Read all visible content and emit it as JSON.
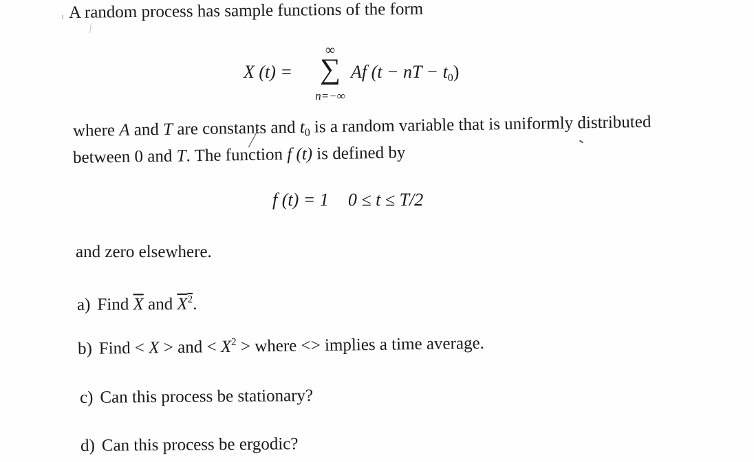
{
  "document": {
    "intro": "A random process has sample functions of the form",
    "equation_1": {
      "lhs": "X (t) =",
      "sum_upper": "∞",
      "sum_symbol": "∑",
      "sum_lower": "n=−∞",
      "rhs_prefix": "Af (t − nT − t",
      "rhs_sub": "0",
      "rhs_suffix": ")"
    },
    "paragraph_2": {
      "line1_part1": "where ",
      "line1_A": "A",
      "line1_part2": " and ",
      "line1_T": "T",
      "line1_part3": " are constants and ",
      "line1_t0": "t",
      "line1_t0_sub": "0",
      "line1_part4": " is a random variable that is uniformly distributed",
      "line2_part1": "between 0 and ",
      "line2_T": "T",
      "line2_part2": ". The function ",
      "line2_f": "f (t)",
      "line2_part3": " is defined by"
    },
    "equation_2": {
      "lhs": "f (t) = 1",
      "condition": "0 ≤ t ≤ T/2"
    },
    "paragraph_3": "and zero elsewhere.",
    "questions": [
      {
        "label": "a)",
        "pre": "Find ",
        "var1": "X",
        "mid": " and ",
        "var2": "X",
        "var2_sup": "2",
        "post": "."
      },
      {
        "label": "b)",
        "pre": "Find < ",
        "var1": "X",
        "mid": " > and < ",
        "var2": "X",
        "var2_sup": "2",
        "post": " > where <> implies a time average."
      },
      {
        "label": "c)",
        "text": "Can this process be stationary?"
      },
      {
        "label": "d)",
        "text": "Can this process be ergodic?"
      }
    ]
  }
}
